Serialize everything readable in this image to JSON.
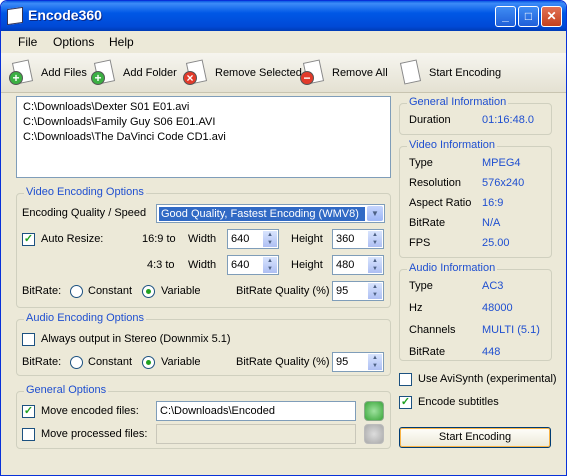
{
  "window": {
    "title": "Encode360",
    "min": "_",
    "max": "□",
    "close": "✕"
  },
  "menu": [
    "File",
    "Options",
    "Help"
  ],
  "toolbar": {
    "add_files": "Add Files",
    "add_folder": "Add Folder",
    "remove_selected": "Remove Selected",
    "remove_all": "Remove All",
    "start": "Start Encoding"
  },
  "files": [
    "C:\\Downloads\\Dexter S01 E01.avi",
    "C:\\Downloads\\Family Guy S06 E01.AVI",
    "C:\\Downloads\\The DaVinci Code CD1.avi"
  ],
  "video": {
    "legend": "Video Encoding Options",
    "quality_label": "Encoding Quality / Speed",
    "quality_value": "Good Quality, Fastest Encoding (WMV8)",
    "auto_resize": "Auto Resize:",
    "r169": "16:9 to",
    "r43": "4:3 to",
    "width": "Width",
    "height": "Height",
    "w169": "640",
    "h169": "360",
    "w43": "640",
    "h43": "480",
    "bitrate": "BitRate:",
    "constant": "Constant",
    "variable": "Variable",
    "bq_label": "BitRate Quality (%)",
    "bq": "95"
  },
  "audio": {
    "legend": "Audio Encoding Options",
    "stereo": "Always output in Stereo (Downmix 5.1)",
    "bitrate": "BitRate:",
    "constant": "Constant",
    "variable": "Variable",
    "bq_label": "BitRate Quality (%)",
    "bq": "95"
  },
  "general": {
    "legend": "General Options",
    "move_encoded": "Move encoded files:",
    "encoded_path": "C:\\Downloads\\Encoded",
    "move_processed": "Move processed files:"
  },
  "geninfo": {
    "legend": "General Information",
    "duration_k": "Duration",
    "duration_v": "01:16:48.0"
  },
  "vinfo": {
    "legend": "Video Information",
    "rows": [
      {
        "k": "Type",
        "v": "MPEG4"
      },
      {
        "k": "Resolution",
        "v": "576x240"
      },
      {
        "k": "Aspect Ratio",
        "v": "16:9"
      },
      {
        "k": "BitRate",
        "v": "N/A"
      },
      {
        "k": "FPS",
        "v": "25.00"
      }
    ]
  },
  "ainfo": {
    "legend": "Audio Information",
    "rows": [
      {
        "k": "Type",
        "v": "AC3"
      },
      {
        "k": "Hz",
        "v": "48000"
      },
      {
        "k": "Channels",
        "v": "MULTI (5.1)"
      },
      {
        "k": "BitRate",
        "v": "448"
      }
    ]
  },
  "options": {
    "avisynth": "Use AviSynth (experimental)",
    "subtitles": "Encode subtitles"
  },
  "start_button": "Start Encoding"
}
